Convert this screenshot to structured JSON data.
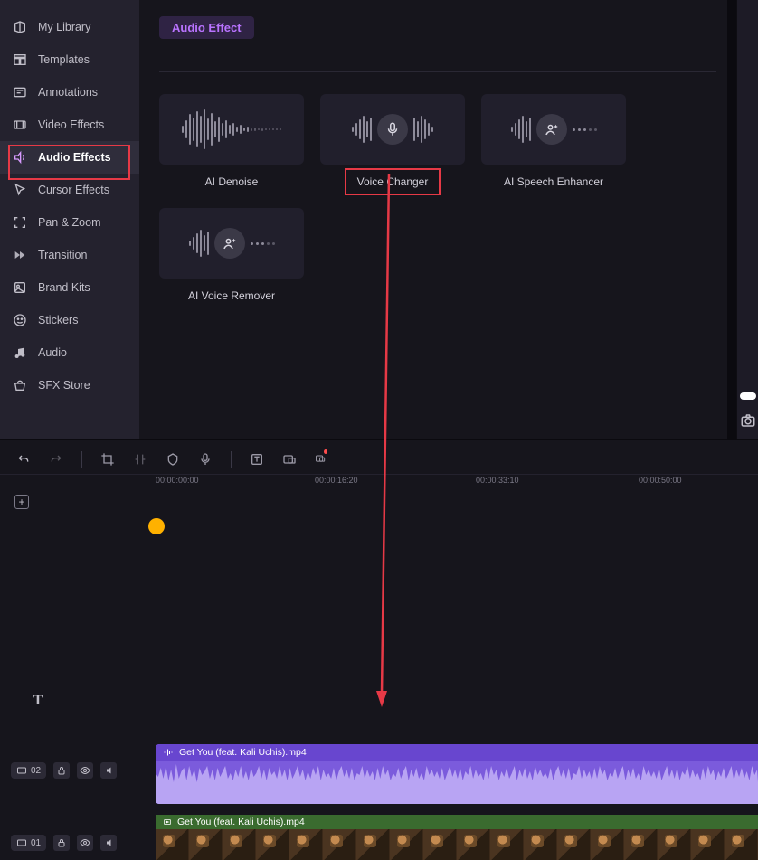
{
  "sidebar": {
    "items": [
      {
        "label": "My Library",
        "icon": "library"
      },
      {
        "label": "Templates",
        "icon": "templates"
      },
      {
        "label": "Annotations",
        "icon": "annotations"
      },
      {
        "label": "Video Effects",
        "icon": "video-effects"
      },
      {
        "label": "Audio Effects",
        "icon": "audio-effects",
        "active": true
      },
      {
        "label": "Cursor Effects",
        "icon": "cursor-effects"
      },
      {
        "label": "Pan & Zoom",
        "icon": "pan-zoom"
      },
      {
        "label": "Transition",
        "icon": "transition"
      },
      {
        "label": "Brand Kits",
        "icon": "brand-kits"
      },
      {
        "label": "Stickers",
        "icon": "stickers"
      },
      {
        "label": "Audio",
        "icon": "audio"
      },
      {
        "label": "SFX Store",
        "icon": "sfx-store"
      }
    ]
  },
  "panel": {
    "header": "Audio Effect",
    "effects": [
      {
        "label": "AI Denoise"
      },
      {
        "label": "Voice Changer",
        "highlighted": true
      },
      {
        "label": "AI Speech Enhancer"
      },
      {
        "label": "AI Voice Remover"
      }
    ]
  },
  "timeline": {
    "ruler": [
      "00:00:00:00",
      "00:00:16:20",
      "00:00:33:10",
      "00:00:50:00"
    ],
    "tracks": {
      "text": {
        "icon": "T"
      },
      "audio": {
        "num": "02",
        "clip_name": "Get You (feat. Kali Uchis).mp4"
      },
      "video": {
        "num": "01",
        "clip_name": "Get You (feat. Kali Uchis).mp4"
      }
    }
  }
}
